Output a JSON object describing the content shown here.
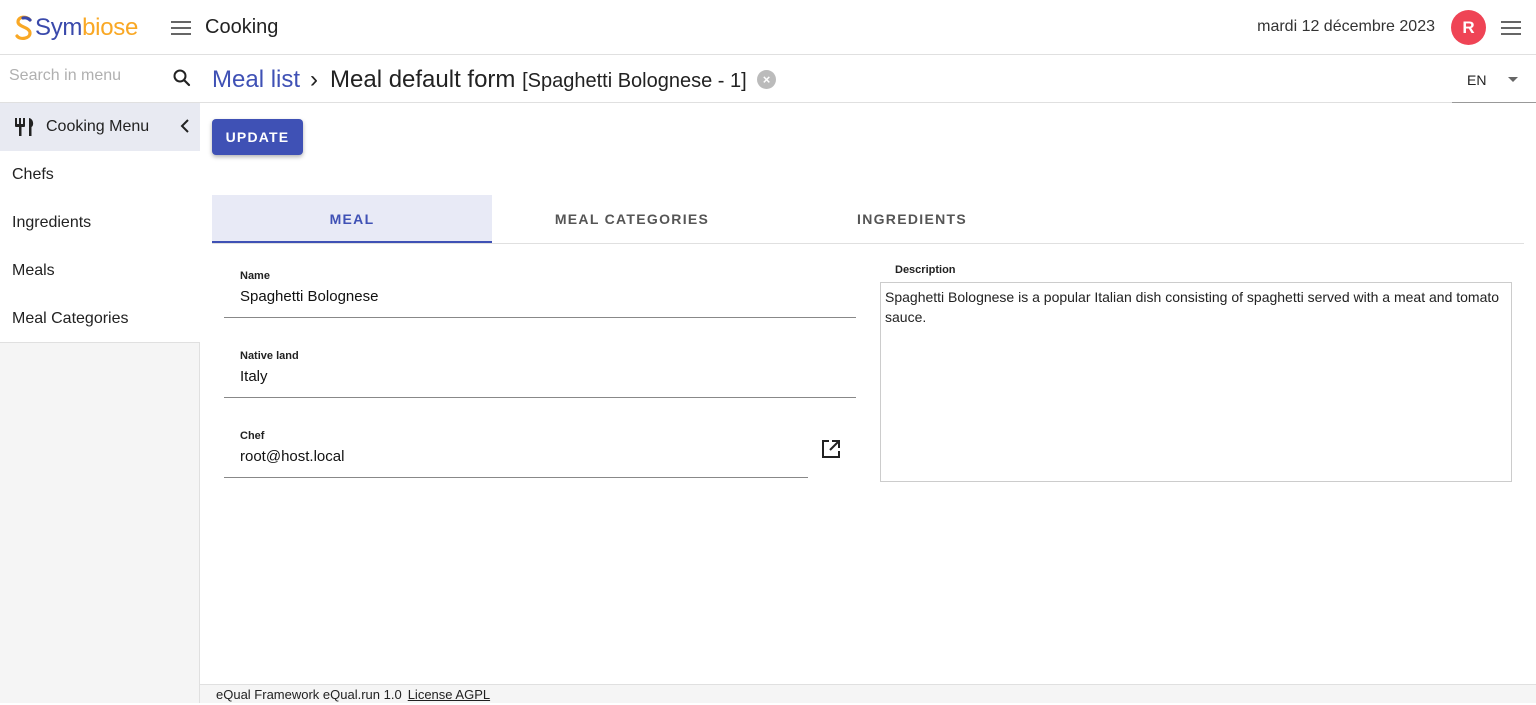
{
  "app": {
    "logo_text_a": "S",
    "logo_text_b": "ym",
    "logo_text_c": "biose",
    "title": "Cooking",
    "date": "mardi 12 décembre 2023",
    "avatar_initial": "R"
  },
  "sidebar": {
    "search_placeholder": "Search in menu",
    "menu_title": "Cooking Menu",
    "items": [
      {
        "label": "Chefs"
      },
      {
        "label": "Ingredients"
      },
      {
        "label": "Meals"
      },
      {
        "label": "Meal Categories"
      }
    ]
  },
  "breadcrumb": {
    "parent": "Meal list",
    "separator": "›",
    "current": "Meal default form",
    "current_sub": "[Spaghetti Bolognese - 1]",
    "close": "×"
  },
  "lang": {
    "value": "EN"
  },
  "toolbar": {
    "update_label": "UPDATE"
  },
  "tabs": [
    {
      "label": "MEAL",
      "active": true
    },
    {
      "label": "MEAL CATEGORIES",
      "active": false
    },
    {
      "label": "INGREDIENTS",
      "active": false
    }
  ],
  "form": {
    "name": {
      "label": "Name",
      "value": "Spaghetti Bolognese"
    },
    "native_land": {
      "label": "Native land",
      "value": "Italy"
    },
    "chef": {
      "label": "Chef",
      "value": "root@host.local"
    },
    "description": {
      "label": "Description",
      "value": "Spaghetti Bolognese is a popular Italian dish consisting of spaghetti served with a meat and tomato sauce."
    }
  },
  "footer": {
    "text": "eQual Framework eQual.run 1.0",
    "license": "License AGPL"
  },
  "colors": {
    "primary": "#3f51b5",
    "avatar": "#ef4455",
    "logo_orange": "#f9a825"
  }
}
